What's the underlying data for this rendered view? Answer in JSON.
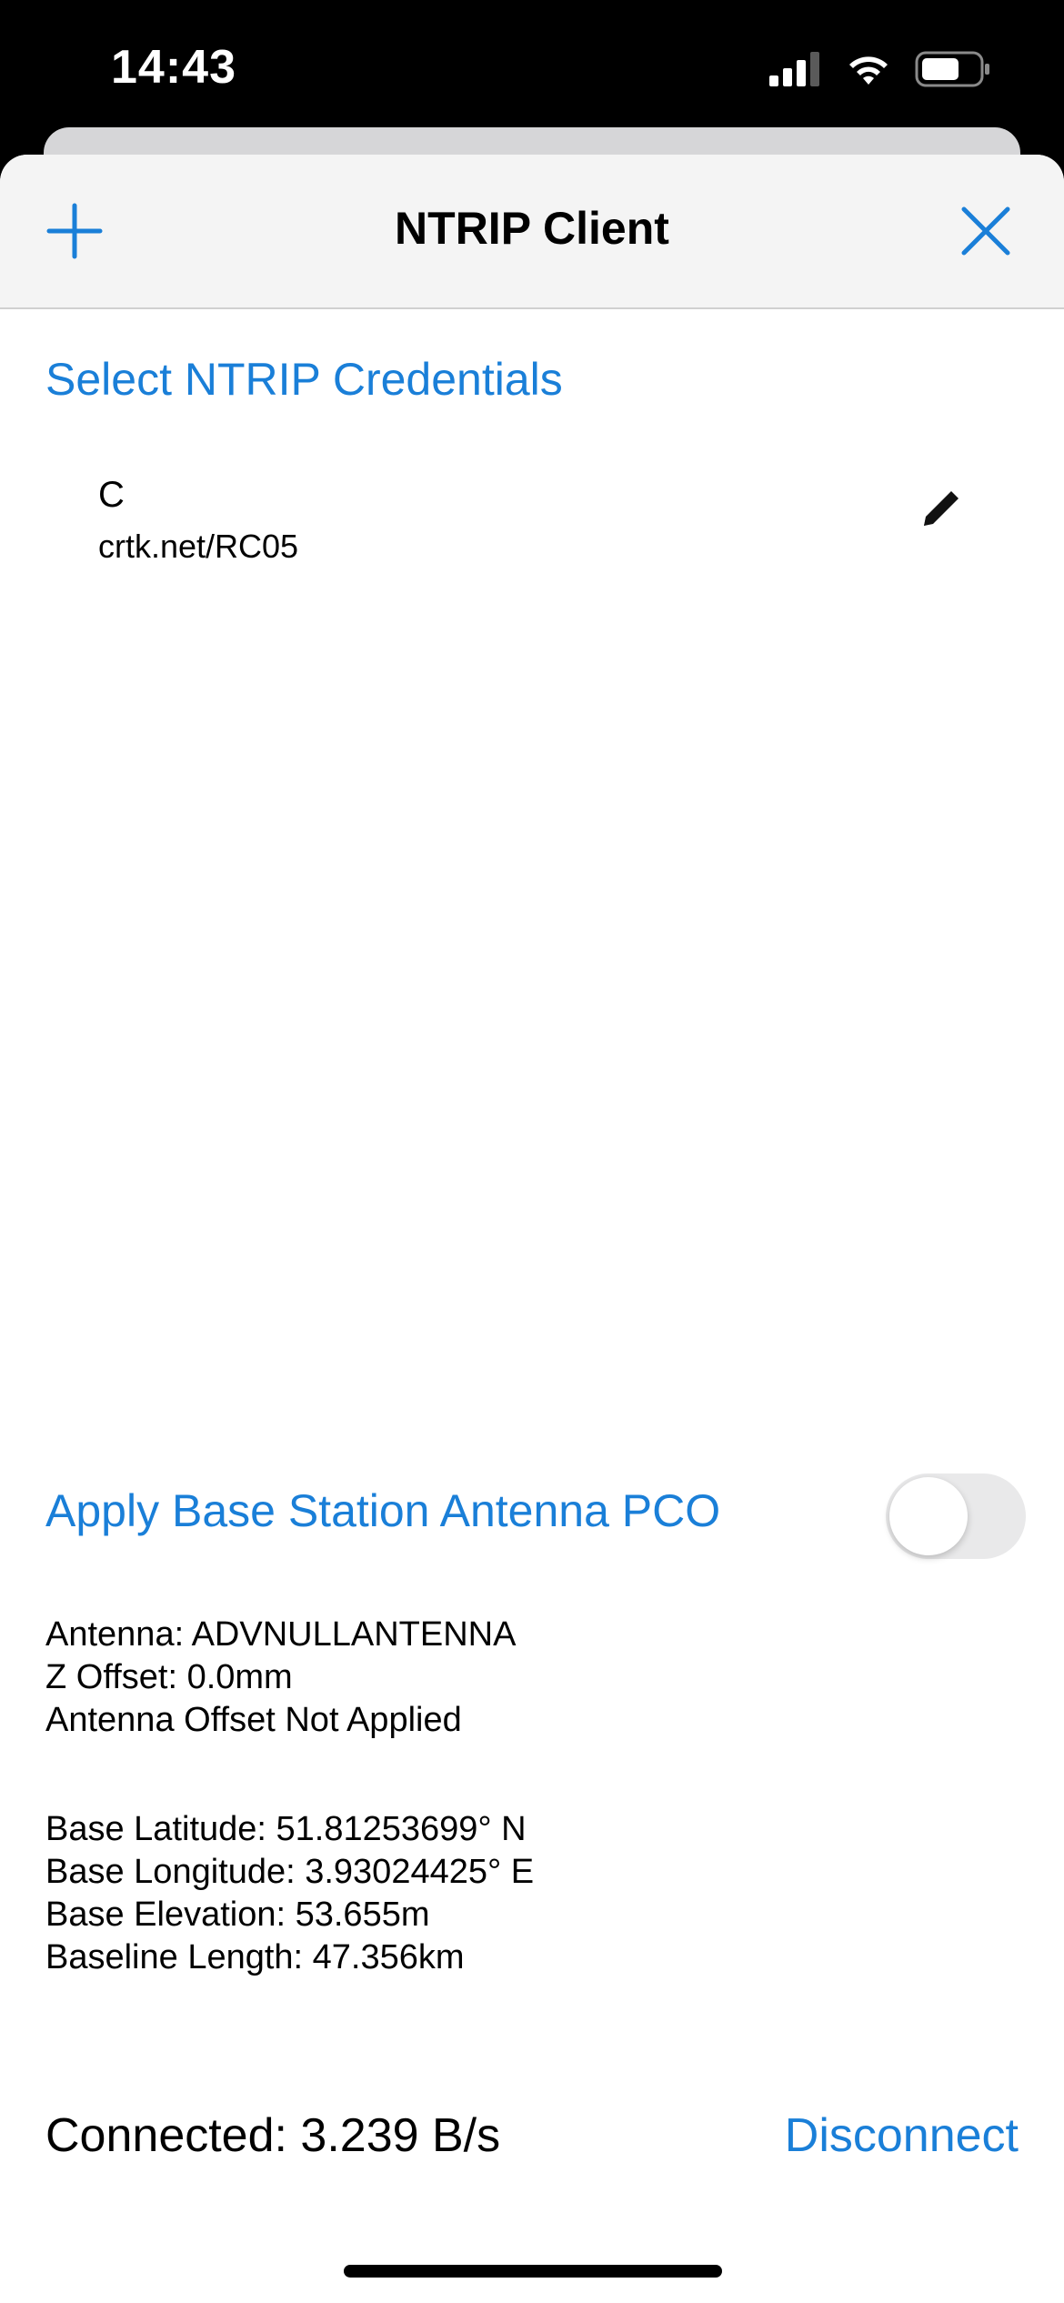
{
  "status_bar": {
    "time": "14:43",
    "icons": [
      "cellular-signal-icon",
      "wifi-icon",
      "battery-icon"
    ]
  },
  "colors": {
    "accent": "#1a7fd8",
    "nav_background": "#f4f4f4",
    "toggle_off": "#e9e9ea"
  },
  "nav": {
    "title": "NTRIP Client",
    "left_icon": "plus-icon",
    "right_icon": "close-icon"
  },
  "credentials": {
    "section_label": "Select NTRIP Credentials",
    "items": [
      {
        "name": "C",
        "url": "crtk.net/RC05",
        "icon": "pencil-icon"
      }
    ]
  },
  "antenna_pco": {
    "label": "Apply Base Station Antenna PCO",
    "enabled": false
  },
  "antenna_info": {
    "antenna": "Antenna: ADVNULLANTENNA",
    "z_offset": "Z Offset: 0.0mm",
    "status": "Antenna Offset Not Applied"
  },
  "base_info": {
    "latitude": "Base Latitude: 51.81253699° N",
    "longitude": "Base Longitude: 3.93024425° E",
    "elevation": "Base Elevation: 53.655m",
    "baseline": "Baseline Length: 47.356km"
  },
  "connection": {
    "status": "Connected: 3.239 B/s",
    "action_label": "Disconnect"
  }
}
